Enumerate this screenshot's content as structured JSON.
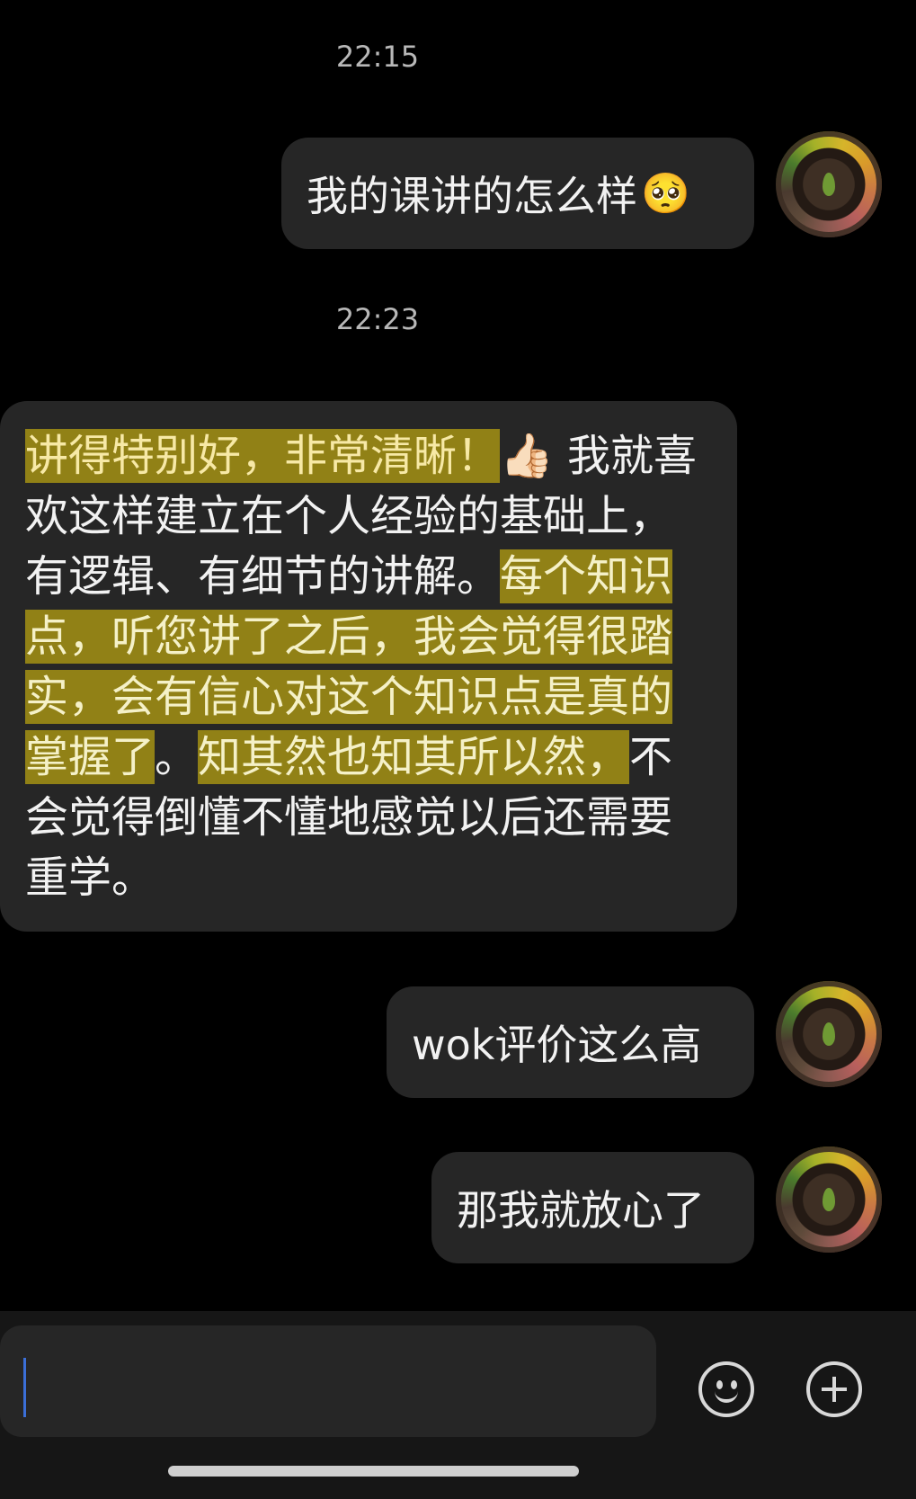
{
  "chat": {
    "time1": "22:15",
    "msg1": "我的课讲的怎么样",
    "msg1_emoji": "🥺",
    "time2": "22:23",
    "reply": {
      "hl1": "讲得特别好，非常清晰！",
      "emoji": "👍🏻",
      "plain1": " 我就喜欢这样建立在个人经验的基础上，有逻辑、有细节的讲解。",
      "hl2": "每个知识点，听您讲了之后，我会觉得很踏实，会有信心对这个知识点是真的掌握了",
      "plain2": "。",
      "hl3": "知其然也知其所以然，",
      "plain3": "不会觉得倒懂不懂地感觉以后还需要重学。"
    },
    "msg2": "wok评价这么高",
    "msg3": "那我就放心了"
  },
  "colors": {
    "background": "#000000",
    "bubble": "#262626",
    "highlight": "#aa9614",
    "caret": "#3b6fd8"
  },
  "icons": [
    "emoji-button-icon",
    "plus-button-icon"
  ]
}
